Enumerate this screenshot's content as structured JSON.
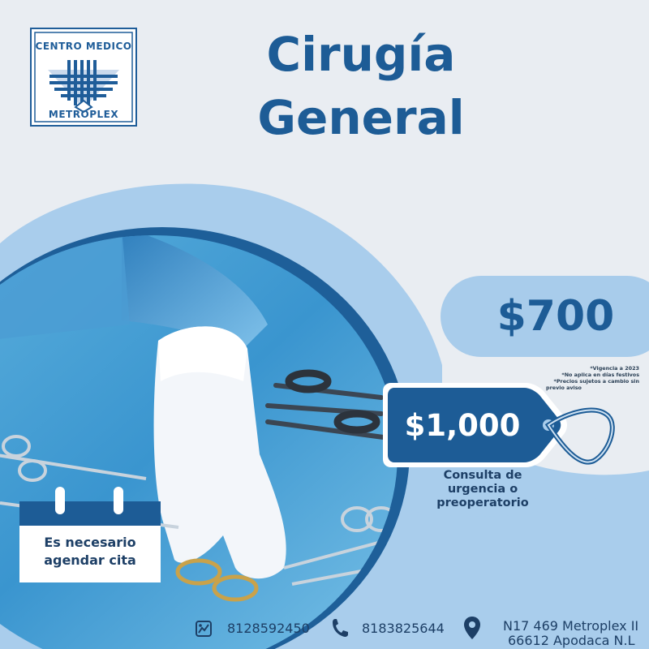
{
  "logo": {
    "top_text": "CENTRO MEDICO",
    "bottom_text": "METROPLEX"
  },
  "title": {
    "line1": "Cirugía",
    "line2": "General"
  },
  "prices": {
    "main_price": "$700",
    "urgent_price": "$1,000"
  },
  "notes": [
    "*Vigencia a 2023",
    "*No aplica en días festivos",
    "*Precios sujetos a cambio sin",
    "previo aviso"
  ],
  "consult_caption": [
    "Consulta de",
    "urgencia o",
    "preoperatorio"
  ],
  "calendar": {
    "line1": "Es necesario",
    "line2": "agendar cita"
  },
  "footer": {
    "phone_whatsapp": "8128592450",
    "phone_call": "8183825644",
    "address_line1": "N17 469 Metroplex II",
    "address_line2": "66612 Apodaca N.L"
  },
  "icons": {
    "whatsapp": "whatsapp-icon",
    "phone": "phone-icon",
    "location": "location-pin-icon"
  },
  "colors": {
    "background": "#e9edf2",
    "primary_blue": "#1d5c96",
    "light_blue": "#a8cceb",
    "dark_text": "#1d3f66"
  }
}
